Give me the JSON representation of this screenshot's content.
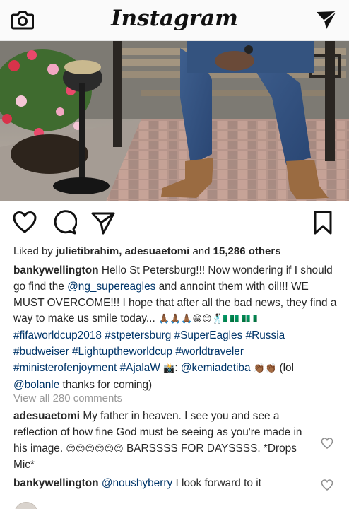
{
  "header": {
    "logo_text": "Instagram",
    "left_icon": "camera-icon",
    "right_icon": "direct-message-icon"
  },
  "post": {
    "liked_by_prefix": "Liked by ",
    "liked_user_1": "julietibrahim",
    "liked_sep": ", ",
    "liked_user_2": "adesuaetomi",
    "liked_and": " and ",
    "liked_others": "15,286 others",
    "caption": {
      "author": "bankywellington",
      "t1": " Hello St Petersburg!!! Now wondering if I should go find the ",
      "m1": "@ng_supereagles",
      "t2": " and annoint them with oil!!! WE MUST OVERCOME!!! I hope that after all the bad news, they find a way to make us smile today... ",
      "emoji1": "🙏🏾🙏🏾🙏🏾😁😊🕺🏿🇳🇬🇳🇬🇳🇬",
      "h1": "#fifaworldcup2018",
      "h2": "#stpetersburg",
      "h3": "#SuperEagles",
      "h4": "#Russia",
      "h5": "#budweiser",
      "h6": "#Lightuptheworldcup",
      "h7": "#worldtraveler",
      "h8": "#ministerofenjoyment",
      "h9": "#AjalaW",
      "emoji2": "📸",
      "t3": ": ",
      "m2": "@kemiadetiba",
      "emoji3": "👏🏾👏🏾",
      "t4": " (lol ",
      "m3": "@bolanle",
      "t5": " thanks for coming)"
    },
    "view_all": "View all 280 comments",
    "comments": [
      {
        "user": "adesuaetomi",
        "text1": " My father in heaven. I see you and see a reflection of how fine God must be seeing as you're made in his image. ",
        "emoji": "😍😍😍😍😍😍",
        "text2": " BARSSSS FOR DAYSSSS. *Drops Mic*"
      },
      {
        "user": "bankywellington",
        "mention": "@noushyberry",
        "text": " I look forward to it"
      }
    ]
  },
  "colors": {
    "link": "#003569",
    "muted": "#999999",
    "text": "#262626"
  }
}
